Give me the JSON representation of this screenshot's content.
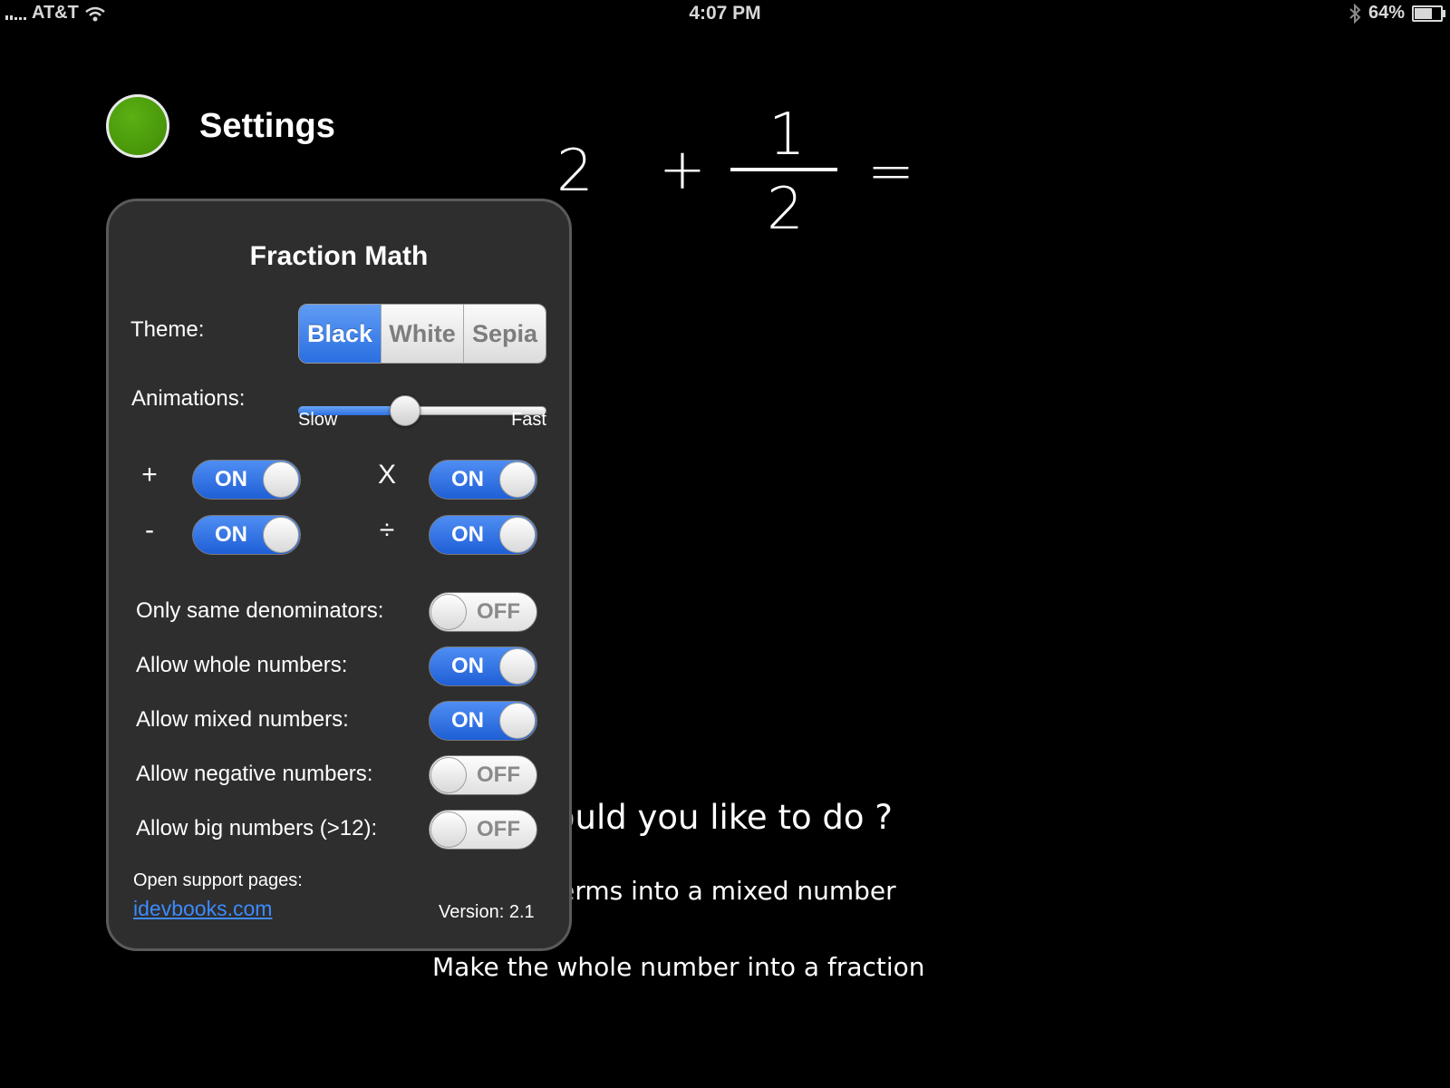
{
  "status_bar": {
    "carrier": "AT&T",
    "time": "4:07 PM",
    "battery": "64%",
    "icons": [
      "signal-icon",
      "wifi-icon",
      "bluetooth-icon",
      "battery-icon"
    ]
  },
  "header": {
    "title": "Settings",
    "status_color": "#4a9a0a"
  },
  "equation": {
    "whole": "2",
    "operator": "+",
    "numerator": "1",
    "denominator": "2",
    "equals": "="
  },
  "background": {
    "prompt": "vould you like to do ?",
    "option_1": "e terms into a mixed number",
    "option_2": "Make the whole number into a fraction"
  },
  "popover": {
    "title": "Fraction Math",
    "theme": {
      "label": "Theme:",
      "options": [
        "Black",
        "White",
        "Sepia"
      ],
      "selected": "Black"
    },
    "animations": {
      "label": "Animations:",
      "min_label": "Slow",
      "max_label": "Fast",
      "value": 0.43
    },
    "operations": {
      "plus": {
        "symbol": "+",
        "state": "ON"
      },
      "times": {
        "symbol": "X",
        "state": "ON"
      },
      "minus": {
        "symbol": "-",
        "state": "ON"
      },
      "divide": {
        "symbol": "÷",
        "state": "ON"
      }
    },
    "options": [
      {
        "label": "Only same denominators:",
        "state": "OFF"
      },
      {
        "label": "Allow whole numbers:",
        "state": "ON"
      },
      {
        "label": "Allow mixed numbers:",
        "state": "ON"
      },
      {
        "label": "Allow negative numbers:",
        "state": "OFF"
      },
      {
        "label": "Allow big numbers (>12):",
        "state": "OFF"
      }
    ],
    "support_label": "Open support pages:",
    "support_link": "idevbooks.com",
    "version": "Version: 2.1"
  },
  "colors": {
    "accent": "#2a6fe2",
    "link": "#3d8bff",
    "panel": "#2e2e2e"
  }
}
